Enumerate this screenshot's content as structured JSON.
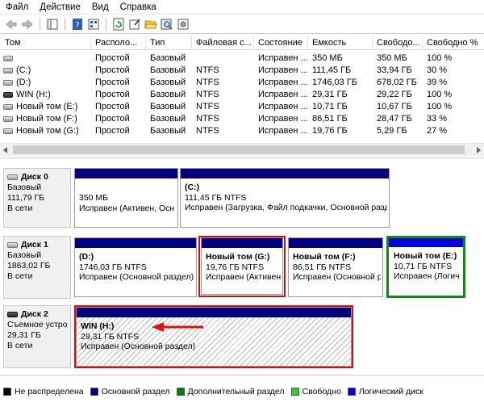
{
  "menu": [
    "Файл",
    "Действие",
    "Вид",
    "Справка"
  ],
  "toolbar_icons": [
    "back-arrow-icon",
    "forward-arrow-icon",
    "console-tree-icon",
    "help-icon",
    "list-view-icon",
    "refresh-icon",
    "properties-icon",
    "open-folder-icon",
    "search-drive-icon",
    "settings-icon"
  ],
  "columns": [
    "Том",
    "Располо...",
    "Тип",
    "Файловая с...",
    "Состояние",
    "Емкость",
    "Свободо...",
    "Свободно %"
  ],
  "volumes": [
    {
      "name": "",
      "layout": "Простой",
      "type": "Базовый",
      "fs": "",
      "status": "Исправен ...",
      "capacity": "350 МБ",
      "free": "350 МБ",
      "free_pct": "100 %"
    },
    {
      "name": "(C:)",
      "layout": "Простой",
      "type": "Базовый",
      "fs": "NTFS",
      "status": "Исправен ...",
      "capacity": "111,45 ГБ",
      "free": "33,94 ГБ",
      "free_pct": "30 %"
    },
    {
      "name": "(D:)",
      "layout": "Простой",
      "type": "Базовый",
      "fs": "NTFS",
      "status": "Исправен ...",
      "capacity": "1746,03 ГБ",
      "free": "678,02 ГБ",
      "free_pct": "39 %"
    },
    {
      "name": "WIN (H:)",
      "layout": "Простой",
      "type": "Базовый",
      "fs": "NTFS",
      "status": "Исправен ...",
      "capacity": "29,31 ГБ",
      "free": "29,22 ГБ",
      "free_pct": "100 %"
    },
    {
      "name": "Новый том (E:)",
      "layout": "Простой",
      "type": "Базовый",
      "fs": "NTFS",
      "status": "Исправен ...",
      "capacity": "10,71 ГБ",
      "free": "10,67 ГБ",
      "free_pct": "100 %"
    },
    {
      "name": "Новый том (F:)",
      "layout": "Простой",
      "type": "Базовый",
      "fs": "NTFS",
      "status": "Исправен ...",
      "capacity": "86,51 ГБ",
      "free": "28,47 ГБ",
      "free_pct": "33 %"
    },
    {
      "name": "Новый том (G:)",
      "layout": "Простой",
      "type": "Базовый",
      "fs": "NTFS",
      "status": "Исправен ...",
      "capacity": "19,76 ГБ",
      "free": "5,29 ГБ",
      "free_pct": "27 %"
    }
  ],
  "disks": [
    {
      "label": [
        "Диск 0",
        "Базовый",
        "111,79 ГБ",
        "В сети"
      ],
      "partitions": [
        {
          "name": "",
          "size": "350 МБ",
          "status": "Исправен (Активен, Осн"
        },
        {
          "name": "(C:)",
          "size": "111,45 ГБ NTFS",
          "status": "Исправен (Загрузка, Файл подкачки, Основной раздел"
        }
      ]
    },
    {
      "label": [
        "Диск 1",
        "Базовый",
        "1863,02 ГБ",
        "В сети"
      ],
      "partitions": [
        {
          "name": "(D:)",
          "size": "1746,03 ГБ NTFS",
          "status": "Исправен (Основной раздел)"
        },
        {
          "name": "Новый том  (G:)",
          "size": "19,76 ГБ NTFS",
          "status": "Исправен (Активен,"
        },
        {
          "name": "Новый том  (F:)",
          "size": "86,51 ГБ NTFS",
          "status": "Исправен (Основной р"
        },
        {
          "name": "Новый том  (E:)",
          "size": "10,71 ГБ NTFS",
          "status": "Исправен (Логич"
        }
      ]
    },
    {
      "label": [
        "Диск 2",
        "Съемное устро",
        "29,31 ГБ",
        "В сети"
      ],
      "partitions": [
        {
          "name": "WIN  (H:)",
          "size": "29,31 ГБ NTFS",
          "status": "Исправен (Основной раздел)"
        }
      ]
    }
  ],
  "legend": [
    {
      "label": "Не распределена",
      "color": "#000000"
    },
    {
      "label": "Основной раздел",
      "color": "#000080"
    },
    {
      "label": "Дополнительный раздел",
      "color": "#008000"
    },
    {
      "label": "Свободно",
      "color": "#33cc33"
    },
    {
      "label": "Логический диск",
      "color": "#0000dd"
    }
  ]
}
